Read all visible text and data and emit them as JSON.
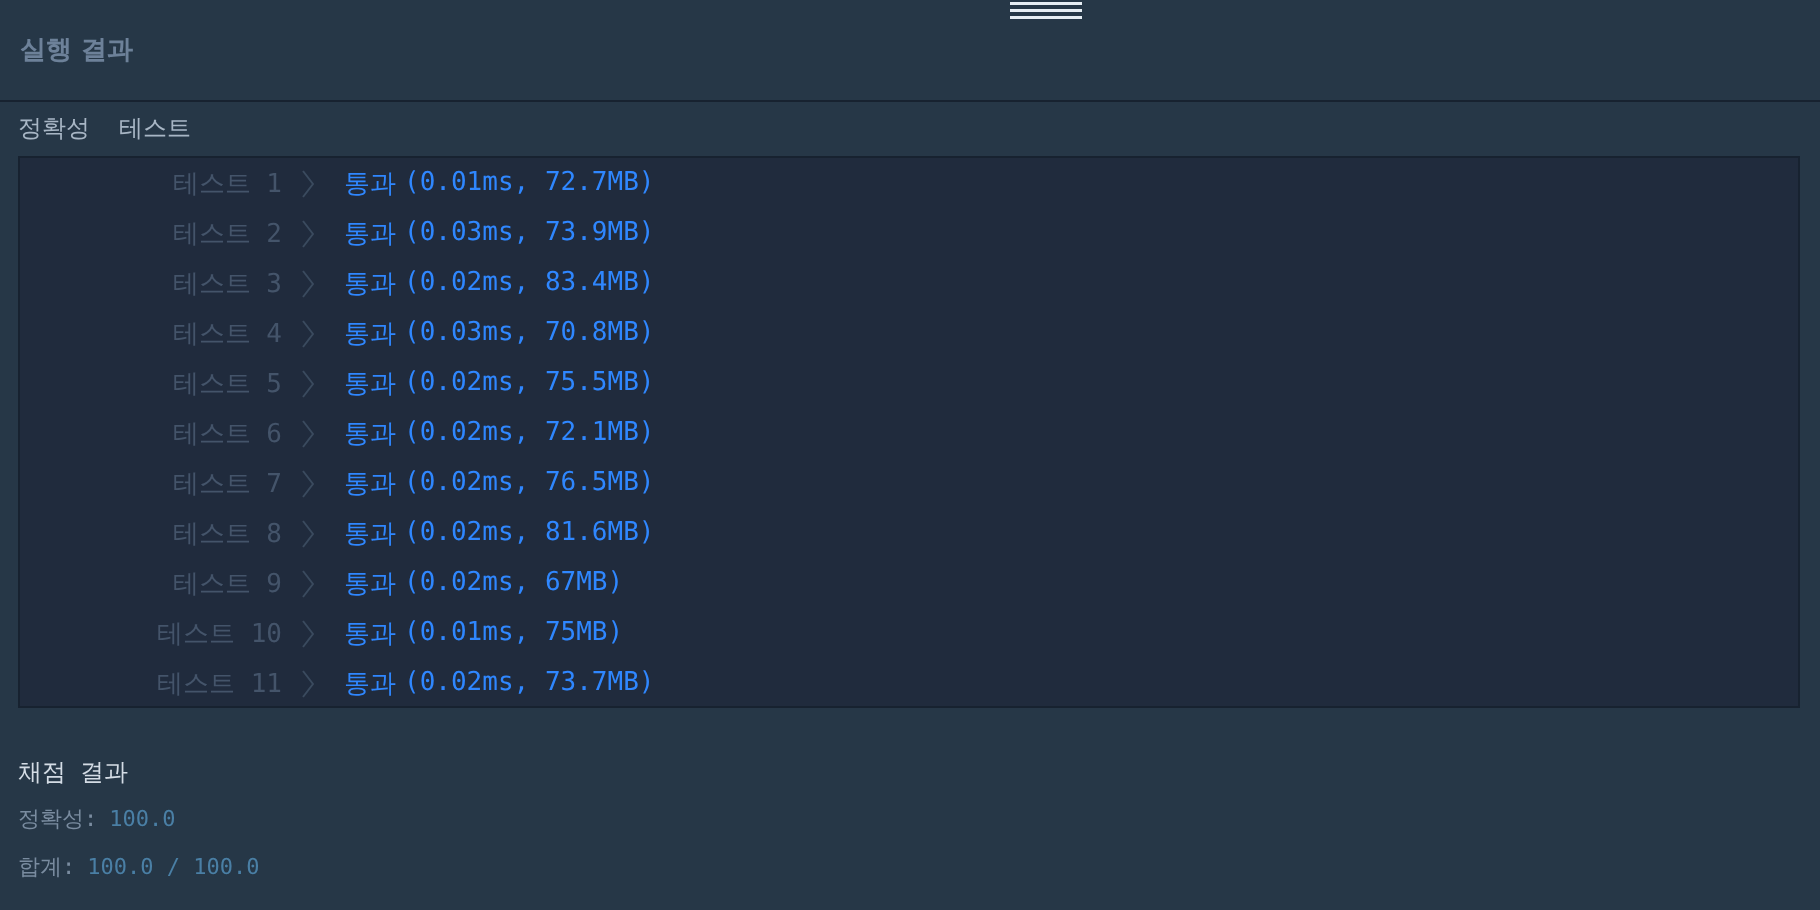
{
  "panel_title": "실행 결과",
  "section_title": "정확성  테스트",
  "tests": [
    {
      "label": "테스트 1",
      "result": "통과",
      "detail": "(0.01ms, 72.7MB)"
    },
    {
      "label": "테스트 2",
      "result": "통과",
      "detail": "(0.03ms, 73.9MB)"
    },
    {
      "label": "테스트 3",
      "result": "통과",
      "detail": "(0.02ms, 83.4MB)"
    },
    {
      "label": "테스트 4",
      "result": "통과",
      "detail": "(0.03ms, 70.8MB)"
    },
    {
      "label": "테스트 5",
      "result": "통과",
      "detail": "(0.02ms, 75.5MB)"
    },
    {
      "label": "테스트 6",
      "result": "통과",
      "detail": "(0.02ms, 72.1MB)"
    },
    {
      "label": "테스트 7",
      "result": "통과",
      "detail": "(0.02ms, 76.5MB)"
    },
    {
      "label": "테스트 8",
      "result": "통과",
      "detail": "(0.02ms, 81.6MB)"
    },
    {
      "label": "테스트 9",
      "result": "통과",
      "detail": "(0.02ms, 67MB)"
    },
    {
      "label": "테스트 10",
      "result": "통과",
      "detail": "(0.01ms, 75MB)"
    },
    {
      "label": "테스트 11",
      "result": "통과",
      "detail": "(0.02ms, 73.7MB)"
    }
  ],
  "grading": {
    "title": "채점 결과",
    "lines": [
      {
        "label": "정확성:",
        "value": "100.0"
      },
      {
        "label": "합계:",
        "value": "100.0 / 100.0"
      }
    ]
  }
}
